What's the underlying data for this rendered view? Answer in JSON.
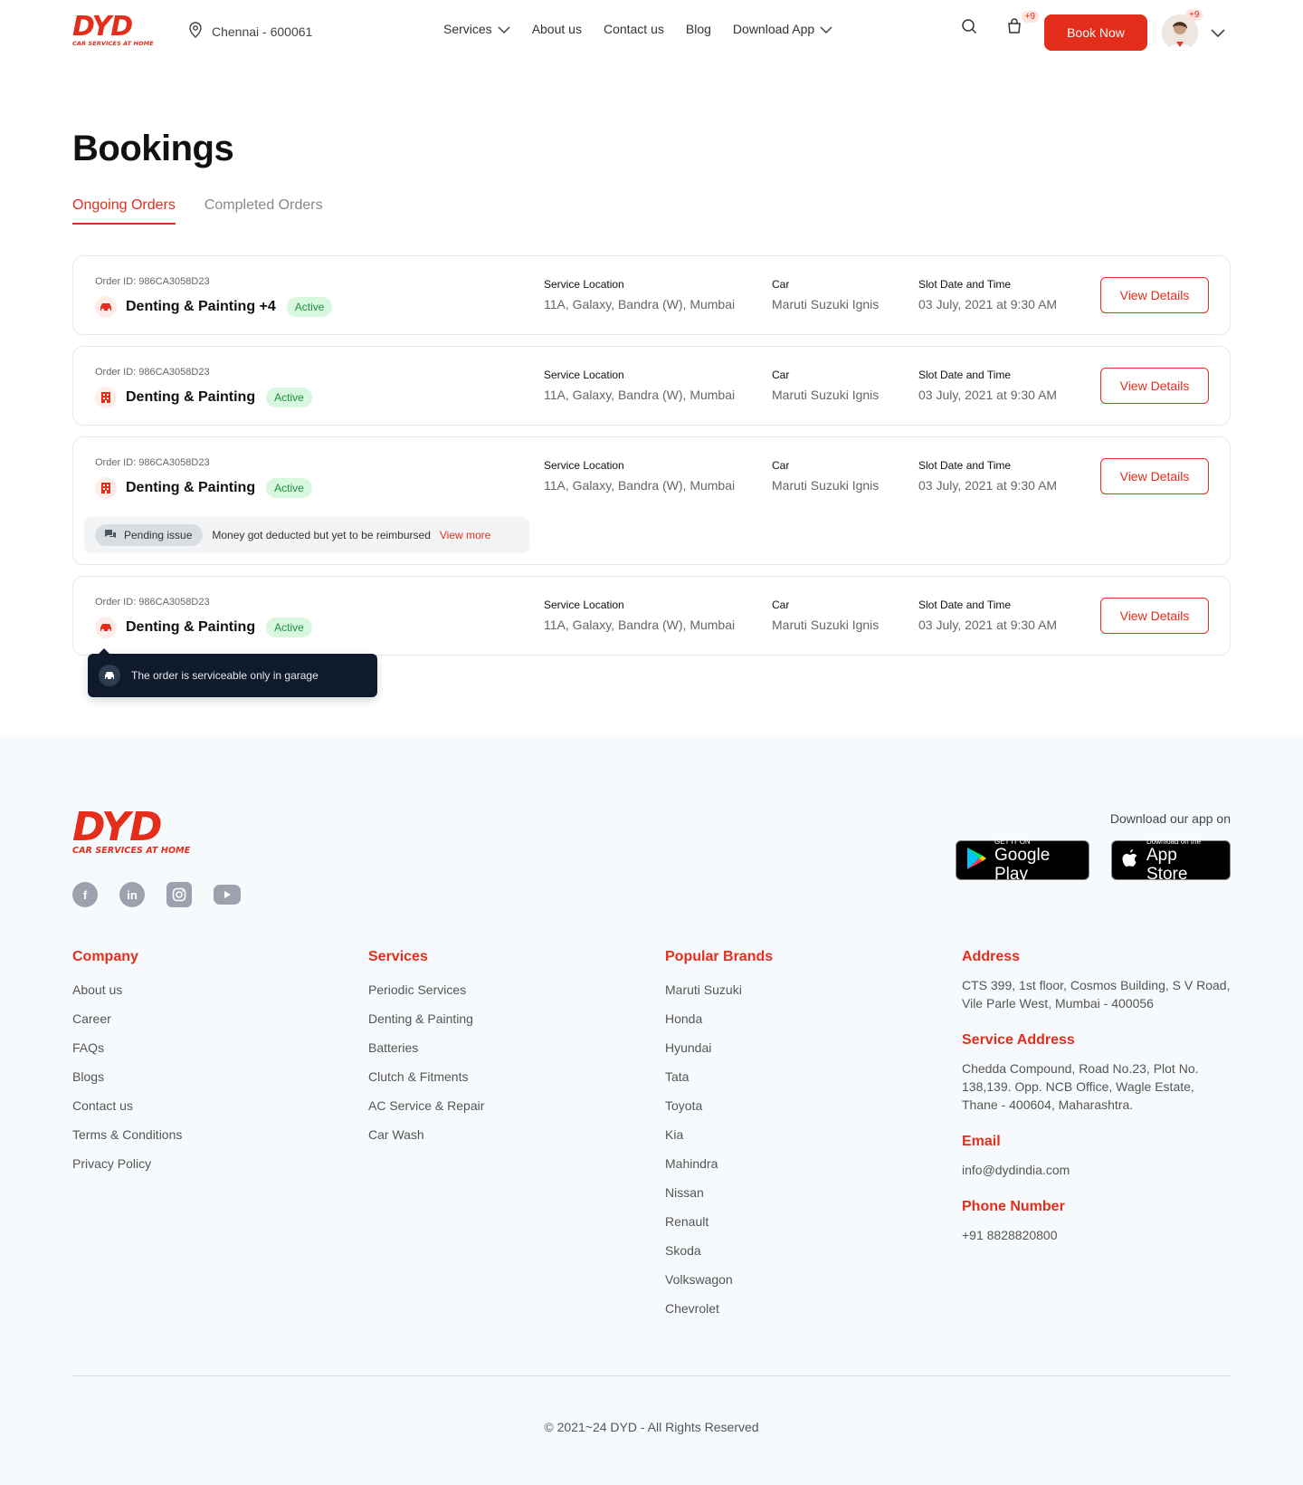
{
  "brand": {
    "name": "DYD",
    "tagline": "CAR SERVICES AT HOME"
  },
  "header": {
    "location": "Chennai - 600061",
    "nav": [
      {
        "label": "Services",
        "dropdown": true
      },
      {
        "label": "About us",
        "dropdown": false
      },
      {
        "label": "Contact us",
        "dropdown": false
      },
      {
        "label": "Blog",
        "dropdown": false
      },
      {
        "label": "Download App",
        "dropdown": true
      }
    ],
    "cart_badge": "+9",
    "book_label": "Book Now",
    "avatar_badge": "+9"
  },
  "page": {
    "title": "Bookings",
    "tabs": [
      {
        "label": "Ongoing Orders",
        "active": true
      },
      {
        "label": "Completed Orders",
        "active": false
      }
    ]
  },
  "labels": {
    "location": "Service Location",
    "car": "Car",
    "slot": "Slot Date and Time",
    "view_details": "View Details",
    "active": "Active"
  },
  "orders": [
    {
      "order_id": "Order ID: 986CA3058D23",
      "service": "Denting & Painting +4",
      "icon": "car-icon",
      "location": "11A, Galaxy, Bandra (W), Mumbai",
      "car": "Maruti Suzuki Ignis",
      "slot": "03 July, 2021 at 9:30 AM"
    },
    {
      "order_id": "Order ID: 986CA3058D23",
      "service": "Denting & Painting",
      "icon": "building-icon",
      "location": "11A, Galaxy, Bandra (W), Mumbai",
      "car": "Maruti Suzuki Ignis",
      "slot": "03 July, 2021 at 9:30 AM"
    },
    {
      "order_id": "Order ID: 986CA3058D23",
      "service": "Denting & Painting",
      "icon": "building-icon",
      "location": "11A, Galaxy, Bandra (W), Mumbai",
      "car": "Maruti Suzuki Ignis",
      "slot": "03 July, 2021 at 9:30 AM",
      "issue": {
        "chip": "Pending issue",
        "text": "Money got deducted but yet to be reimbursed",
        "link": "View more"
      }
    },
    {
      "order_id": "Order ID: 986CA3058D23",
      "service": "Denting & Painting",
      "icon": "car-icon",
      "location": "11A, Galaxy, Bandra (W), Mumbai",
      "car": "Maruti Suzuki Ignis",
      "slot": "03 July, 2021 at 9:30 AM"
    }
  ],
  "tooltip": {
    "text": "The order is serviceable only in garage"
  },
  "footer": {
    "download_label": "Download our app on",
    "google_play": {
      "small": "GET IT ON",
      "big": "Google Play"
    },
    "app_store": {
      "small": "Download on the",
      "big": "App Store"
    },
    "socials": [
      "facebook-icon",
      "linkedin-icon",
      "instagram-icon",
      "youtube-icon"
    ],
    "company": {
      "title": "Company",
      "items": [
        "About us",
        "Career",
        "FAQs",
        "Blogs",
        "Contact us",
        "Terms & Conditions",
        "Privacy Policy"
      ]
    },
    "services": {
      "title": "Services",
      "items": [
        "Periodic Services",
        "Denting & Painting",
        "Batteries",
        "Clutch & Fitments",
        "AC Service & Repair",
        "Car Wash"
      ]
    },
    "brands": {
      "title": "Popular Brands",
      "items": [
        "Maruti Suzuki",
        "Honda",
        "Hyundai",
        "Tata",
        "Toyota",
        "Kia",
        "Mahindra",
        "Nissan",
        "Renault",
        "Skoda",
        "Volkswagon",
        "Chevrolet"
      ]
    },
    "address": {
      "title": "Address",
      "text": "CTS 399, 1st floor, Cosmos Building, S V Road, Vile Parle West, Mumbai - 400056"
    },
    "service_address": {
      "title": "Service Address",
      "text": "Chedda Compound, Road No.23, Plot No. 138,139. Opp. NCB Office, Wagle Estate, Thane - 400604, Maharashtra."
    },
    "email": {
      "title": "Email",
      "text": "info@dydindia.com"
    },
    "phone": {
      "title": "Phone Number",
      "text": "+91 8828820800"
    },
    "copyright": "© 2021~24 DYD - All Rights Reserved"
  },
  "colors": {
    "accent": "#E42D1B",
    "active_bg": "#D7F7DE",
    "active_text": "#1E8F3C",
    "tooltip_bg": "#0F1B2D",
    "footer_bg": "#F7FAFC"
  }
}
